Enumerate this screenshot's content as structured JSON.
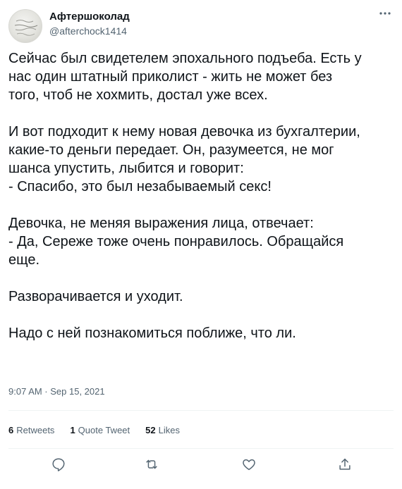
{
  "author": {
    "display_name": "Афтершоколад",
    "handle": "@afterchock1414"
  },
  "more_icon": "more-horizontal-icon",
  "tweet": {
    "paragraphs": [
      "Сейчас был свидетелем эпохального подъеба. Есть у\nнас один штатный приколист - жить не может без\nтого, чтоб не хохмить, достал уже всех.",
      "И вот подходит к нему новая девочка из бухгалтерии,\nкакие-то деньги передает. Он, разумеется, не мог\nшанса упустить, лыбится и говорит:\n- Спасибо, это был незабываемый секс!",
      "Девочка, не меняя выражения лица, отвечает:\n- Да, Сереже тоже очень понравилось. Обращайся\nеще.",
      "Разворачивается и уходит.",
      "Надо с ней познакомиться поближе, что ли."
    ],
    "timestamp": "9:07 AM · Sep 15, 2021"
  },
  "stats": {
    "retweets_count": "6",
    "retweets_label": "Retweets",
    "quotes_count": "1",
    "quotes_label": "Quote Tweet",
    "likes_count": "52",
    "likes_label": "Likes"
  },
  "actions": [
    "reply-icon",
    "retweet-icon",
    "like-icon",
    "share-icon"
  ],
  "colors": {
    "text": "#0f1419",
    "secondary": "#536471",
    "divider": "#eff3f4"
  }
}
